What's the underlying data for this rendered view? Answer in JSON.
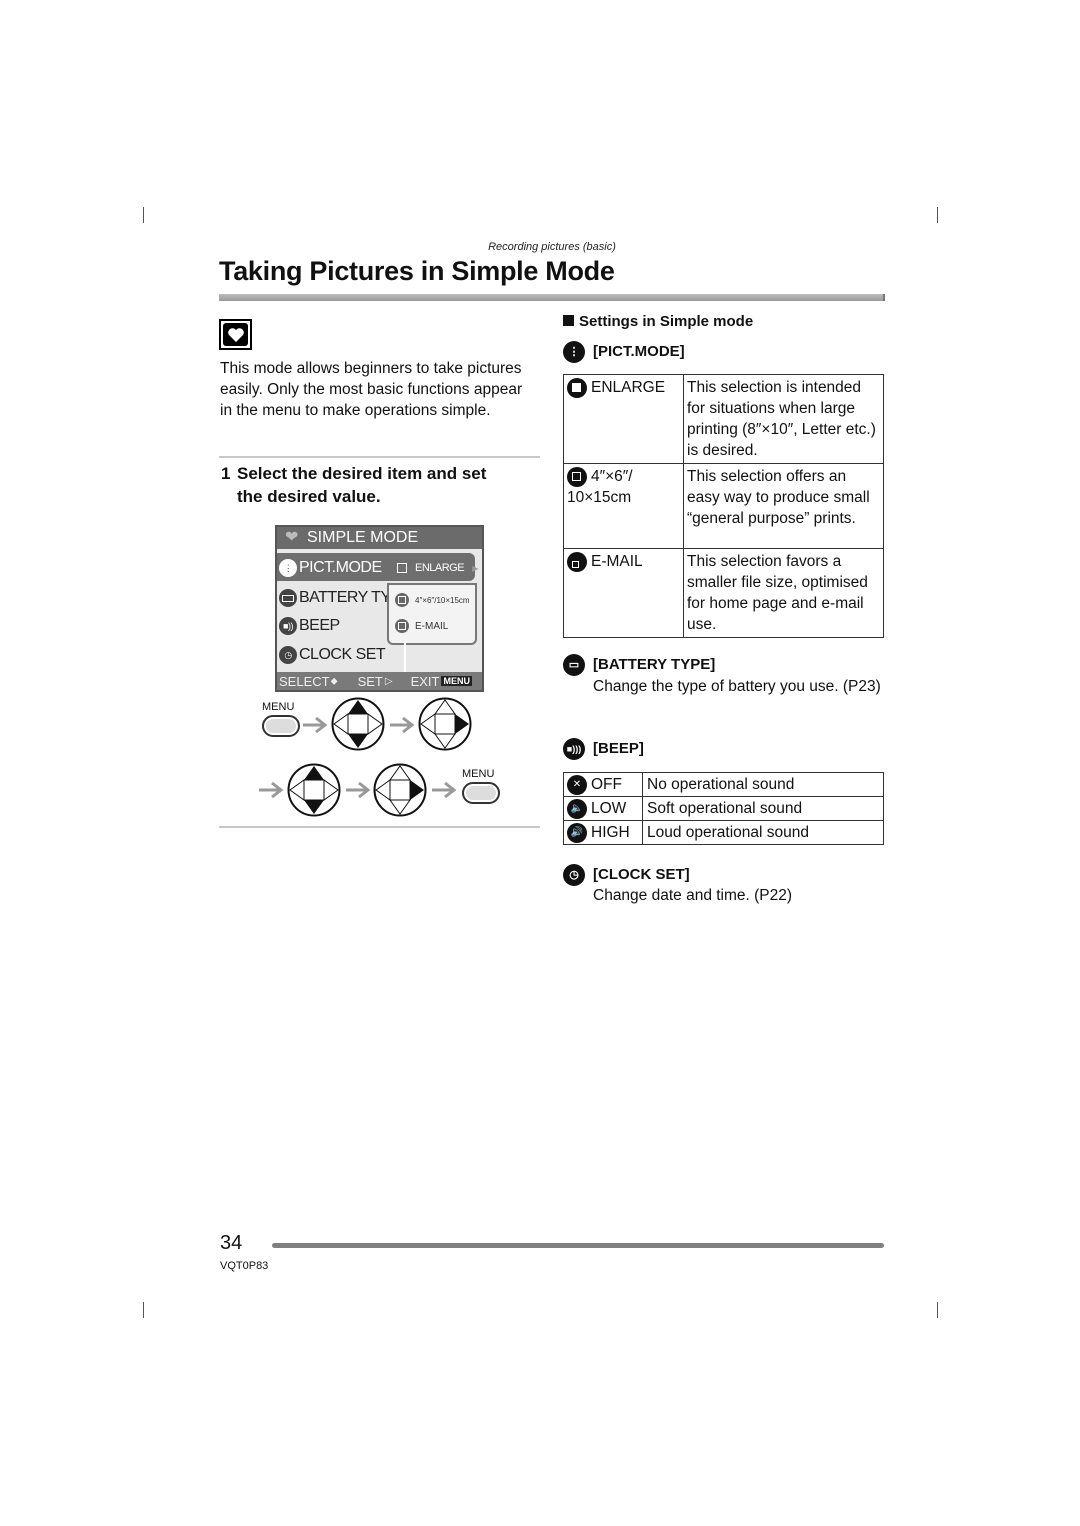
{
  "page": {
    "running_head": "Recording pictures (basic)",
    "title": "Taking Pictures in Simple Mode",
    "page_number": "34",
    "doc_code": "VQT0P83"
  },
  "left": {
    "mode_icon": "heart-mode-icon",
    "intro": "This mode allows beginners to take pictures easily. Only the most basic functions appear in the menu to make operations simple.",
    "step_number": "1",
    "step_line1": "Select the desired item and set",
    "step_line2": "the desired value.",
    "lcd": {
      "header": "SIMPLE MODE",
      "items": [
        "PICT.MODE",
        "BATTERY TY",
        "BEEP",
        "CLOCK SET"
      ],
      "options": [
        "ENLARGE",
        "4″×6″/10×15cm",
        "E-MAIL"
      ],
      "footer_select": "SELECT",
      "footer_set": "SET",
      "footer_exit": "EXIT",
      "footer_menu": "MENU"
    },
    "diagram": {
      "menu_label_1": "MENU",
      "menu_label_2": "MENU"
    }
  },
  "right": {
    "section_title": "Settings in Simple mode",
    "pict_mode": {
      "title": "[PICT.MODE]",
      "rows": [
        {
          "label": "ENLARGE",
          "desc": "This selection is intended for situations when large printing (8″×10″, Letter etc.) is desired."
        },
        {
          "label": "4″×6″/ 10×15cm",
          "desc": "This selection offers an easy way to produce small “general purpose” prints."
        },
        {
          "label": "E-MAIL",
          "desc": "This selection favors a smaller file size, optimised for home page and e-mail use."
        }
      ]
    },
    "battery_type": {
      "title": "[BATTERY TYPE]",
      "desc": "Change the type of battery you use. (P23)"
    },
    "beep": {
      "title": "[BEEP]",
      "rows": [
        {
          "label": "OFF",
          "desc": "No operational sound"
        },
        {
          "label": "LOW",
          "desc": "Soft operational sound"
        },
        {
          "label": "HIGH",
          "desc": "Loud operational sound"
        }
      ]
    },
    "clock_set": {
      "title": "[CLOCK SET]",
      "desc": "Change date and time. (P22)"
    }
  }
}
